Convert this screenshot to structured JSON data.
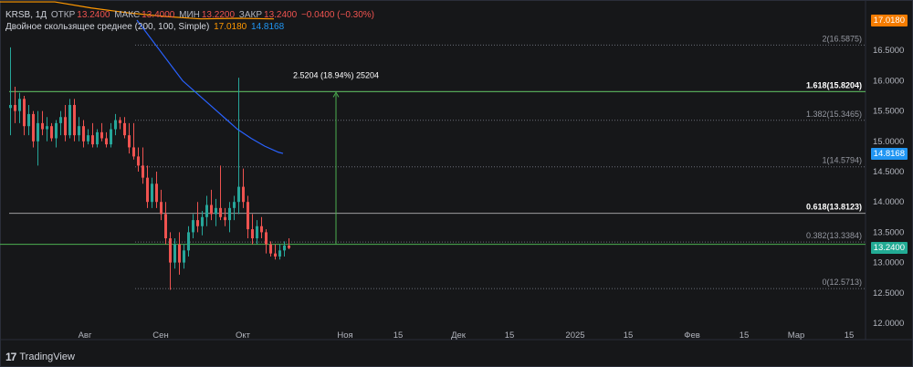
{
  "header": {
    "symbol": "KRSB, 1Д",
    "open_label": "ОТКР",
    "open": "13.2400",
    "high_label": "МАКС",
    "high": "13.4000",
    "low_label": "МИН",
    "low": "13.2200",
    "close_label": "ЗАКР",
    "close": "13.2400",
    "change": "−0.0400 (−0.30%)",
    "ma_label": "Двойное скользящее среднее (200, 100, Simple)",
    "ma_fast": "17.0180",
    "ma_slow": "14.8168"
  },
  "colors": {
    "up": "#26a69a",
    "down": "#ef5350",
    "ma_fast": "#ff9800",
    "ma_slow": "#2962ff",
    "fib_key": "#4caf50",
    "price_line": "#4caf50",
    "price_tag": "#22ab94",
    "ma_tag": "#2196f3",
    "ma_fast_tag": "#f57c00"
  },
  "branding": {
    "logo_icon": "tradingview-logo-icon",
    "name": "TradingView"
  },
  "chart_data": {
    "type": "candlestick",
    "y_axis": {
      "min": 12.0,
      "max": 17.0,
      "ticks": [
        "12.0000",
        "12.5000",
        "13.0000",
        "13.5000",
        "14.0000",
        "14.5000",
        "15.0000",
        "15.5000",
        "16.0000",
        "16.5000"
      ]
    },
    "x_axis_labels": [
      "Авг",
      "Сен",
      "Окт",
      "Ноя",
      "15",
      "Дек",
      "15",
      "2025",
      "15",
      "Фев",
      "15",
      "Мар",
      "15"
    ],
    "current_price": "13.2400",
    "fib_levels": [
      {
        "label": "2(16.5875)",
        "value": 16.5875,
        "key": false
      },
      {
        "label": "1.618(15.8204)",
        "value": 15.8204,
        "key": true
      },
      {
        "label": "1.382(15.3465)",
        "value": 15.3465,
        "key": false
      },
      {
        "label": "1(14.5794)",
        "value": 14.5794,
        "key": false
      },
      {
        "label": "0.618(13.8123)",
        "value": 13.8123,
        "key": true
      },
      {
        "label": "0.382(13.3384)",
        "value": 13.3384,
        "key": false
      },
      {
        "label": "0(12.5713)",
        "value": 12.5713,
        "key": false
      }
    ],
    "measure_label": "2.5204 (18.94%) 25204",
    "measure": {
      "from": 13.3,
      "to": 15.82
    },
    "candles": [
      {
        "o": 15.55,
        "h": 16.55,
        "l": 15.1,
        "c": 15.6
      },
      {
        "o": 15.6,
        "h": 15.9,
        "l": 15.3,
        "c": 15.5
      },
      {
        "o": 15.5,
        "h": 15.8,
        "l": 15.3,
        "c": 15.7
      },
      {
        "o": 15.7,
        "h": 15.75,
        "l": 15.1,
        "c": 15.25
      },
      {
        "o": 15.25,
        "h": 15.6,
        "l": 15.1,
        "c": 15.45
      },
      {
        "o": 15.45,
        "h": 15.5,
        "l": 14.9,
        "c": 15.0
      },
      {
        "o": 15.0,
        "h": 15.5,
        "l": 14.6,
        "c": 15.3
      },
      {
        "o": 15.3,
        "h": 15.5,
        "l": 15.1,
        "c": 15.2
      },
      {
        "o": 15.2,
        "h": 15.4,
        "l": 15.0,
        "c": 15.25
      },
      {
        "o": 15.25,
        "h": 15.3,
        "l": 15.0,
        "c": 15.05
      },
      {
        "o": 15.05,
        "h": 15.35,
        "l": 14.9,
        "c": 15.3
      },
      {
        "o": 15.3,
        "h": 15.5,
        "l": 15.1,
        "c": 15.4
      },
      {
        "o": 15.4,
        "h": 15.6,
        "l": 15.0,
        "c": 15.1
      },
      {
        "o": 15.1,
        "h": 15.7,
        "l": 15.05,
        "c": 15.6
      },
      {
        "o": 15.6,
        "h": 15.7,
        "l": 15.0,
        "c": 15.1
      },
      {
        "o": 15.1,
        "h": 15.4,
        "l": 15.0,
        "c": 15.25
      },
      {
        "o": 15.25,
        "h": 15.35,
        "l": 14.9,
        "c": 15.0
      },
      {
        "o": 15.0,
        "h": 15.2,
        "l": 14.95,
        "c": 15.1
      },
      {
        "o": 15.1,
        "h": 15.3,
        "l": 14.9,
        "c": 14.95
      },
      {
        "o": 14.95,
        "h": 15.2,
        "l": 14.9,
        "c": 15.15
      },
      {
        "o": 15.15,
        "h": 15.3,
        "l": 15.0,
        "c": 15.05
      },
      {
        "o": 15.05,
        "h": 15.15,
        "l": 14.9,
        "c": 14.95
      },
      {
        "o": 14.95,
        "h": 15.3,
        "l": 14.9,
        "c": 15.2
      },
      {
        "o": 15.2,
        "h": 15.45,
        "l": 15.1,
        "c": 15.35
      },
      {
        "o": 15.35,
        "h": 15.4,
        "l": 15.2,
        "c": 15.3
      },
      {
        "o": 15.3,
        "h": 15.4,
        "l": 15.05,
        "c": 15.1
      },
      {
        "o": 15.1,
        "h": 15.3,
        "l": 14.8,
        "c": 14.9
      },
      {
        "o": 14.9,
        "h": 15.3,
        "l": 14.7,
        "c": 14.75
      },
      {
        "o": 14.75,
        "h": 14.9,
        "l": 14.5,
        "c": 14.6
      },
      {
        "o": 14.6,
        "h": 14.9,
        "l": 14.3,
        "c": 14.4
      },
      {
        "o": 14.4,
        "h": 14.6,
        "l": 13.9,
        "c": 14.0
      },
      {
        "o": 14.0,
        "h": 14.4,
        "l": 13.9,
        "c": 14.3
      },
      {
        "o": 14.3,
        "h": 14.5,
        "l": 13.9,
        "c": 14.0
      },
      {
        "o": 14.0,
        "h": 14.2,
        "l": 13.7,
        "c": 13.8
      },
      {
        "o": 13.8,
        "h": 14.0,
        "l": 13.3,
        "c": 13.4
      },
      {
        "o": 13.4,
        "h": 13.5,
        "l": 12.55,
        "c": 13.0
      },
      {
        "o": 13.0,
        "h": 13.4,
        "l": 12.9,
        "c": 13.3
      },
      {
        "o": 13.3,
        "h": 13.5,
        "l": 12.8,
        "c": 13.0
      },
      {
        "o": 13.0,
        "h": 13.3,
        "l": 12.9,
        "c": 13.2
      },
      {
        "o": 13.2,
        "h": 13.6,
        "l": 13.1,
        "c": 13.5
      },
      {
        "o": 13.5,
        "h": 13.8,
        "l": 13.4,
        "c": 13.7
      },
      {
        "o": 13.7,
        "h": 14.0,
        "l": 13.5,
        "c": 13.6
      },
      {
        "o": 13.6,
        "h": 13.85,
        "l": 13.45,
        "c": 13.75
      },
      {
        "o": 13.75,
        "h": 14.1,
        "l": 13.6,
        "c": 13.95
      },
      {
        "o": 13.95,
        "h": 14.2,
        "l": 13.7,
        "c": 13.8
      },
      {
        "o": 13.8,
        "h": 14.05,
        "l": 13.6,
        "c": 13.9
      },
      {
        "o": 13.9,
        "h": 14.6,
        "l": 13.7,
        "c": 13.75
      },
      {
        "o": 13.75,
        "h": 13.9,
        "l": 13.6,
        "c": 13.7
      },
      {
        "o": 13.7,
        "h": 14.0,
        "l": 13.5,
        "c": 13.9
      },
      {
        "o": 13.9,
        "h": 14.1,
        "l": 13.7,
        "c": 14.0
      },
      {
        "o": 14.0,
        "h": 16.05,
        "l": 13.8,
        "c": 14.25
      },
      {
        "o": 14.25,
        "h": 14.55,
        "l": 13.9,
        "c": 14.0
      },
      {
        "o": 14.0,
        "h": 14.1,
        "l": 13.4,
        "c": 13.55
      },
      {
        "o": 13.55,
        "h": 13.8,
        "l": 13.3,
        "c": 13.4
      },
      {
        "o": 13.4,
        "h": 13.7,
        "l": 13.3,
        "c": 13.6
      },
      {
        "o": 13.6,
        "h": 13.75,
        "l": 13.4,
        "c": 13.5
      },
      {
        "o": 13.5,
        "h": 13.55,
        "l": 13.15,
        "c": 13.3
      },
      {
        "o": 13.3,
        "h": 13.35,
        "l": 13.1,
        "c": 13.15
      },
      {
        "o": 13.15,
        "h": 13.3,
        "l": 13.05,
        "c": 13.1
      },
      {
        "o": 13.1,
        "h": 13.3,
        "l": 13.05,
        "c": 13.2
      },
      {
        "o": 13.2,
        "h": 13.35,
        "l": 13.1,
        "c": 13.28
      },
      {
        "o": 13.28,
        "h": 13.4,
        "l": 13.22,
        "c": 13.24
      }
    ],
    "ma_fast_series": [
      [
        0,
        17.3
      ],
      [
        20,
        17.3
      ],
      [
        60,
        17.3
      ],
      [
        100,
        17.2
      ],
      [
        140,
        17.12
      ],
      [
        180,
        17.06
      ],
      [
        220,
        17.02
      ],
      [
        260,
        17.03
      ],
      [
        300,
        17.02
      ]
    ],
    "ma_slow_series": [
      [
        150,
        17.0
      ],
      [
        160,
        16.8
      ],
      [
        175,
        16.5
      ],
      [
        190,
        16.2
      ],
      [
        200,
        16.0
      ],
      [
        215,
        15.8
      ],
      [
        230,
        15.6
      ],
      [
        245,
        15.4
      ],
      [
        260,
        15.2
      ],
      [
        275,
        15.05
      ],
      [
        290,
        14.92
      ],
      [
        305,
        14.82
      ],
      [
        310,
        14.8
      ]
    ]
  }
}
